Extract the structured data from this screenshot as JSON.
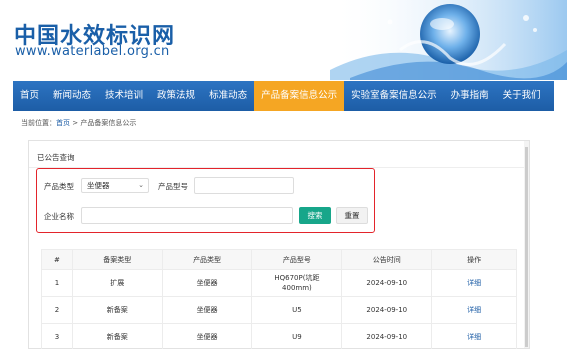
{
  "header": {
    "logo_title": "中国水效标识网",
    "logo_url": "www.waterlabel.org.cn"
  },
  "nav": {
    "items": [
      {
        "label": "首页"
      },
      {
        "label": "新闻动态"
      },
      {
        "label": "技术培训"
      },
      {
        "label": "政策法规"
      },
      {
        "label": "标准动态"
      },
      {
        "label": "产品备案信息公示",
        "active": true
      },
      {
        "label": "实验室备案信息公示"
      },
      {
        "label": "办事指南"
      },
      {
        "label": "关于我们"
      }
    ]
  },
  "breadcrumb": {
    "prefix": "当前位置：",
    "home": "首页",
    "separator": " > ",
    "current": "产品备案信息公示"
  },
  "panel": {
    "title": "已公告查询"
  },
  "search": {
    "product_type_label": "产品类型",
    "product_type_value": "坐便器",
    "product_model_label": "产品型号",
    "product_model_value": "",
    "company_label": "企业名称",
    "company_value": "",
    "search_button": "搜索",
    "reset_button": "重置"
  },
  "table": {
    "headers": [
      "#",
      "备案类型",
      "产品类型",
      "产品型号",
      "公告时间",
      "操作"
    ],
    "rows": [
      {
        "no": "1",
        "type": "扩展",
        "product": "坐便器",
        "model": "HQ670P(坑距400mm)",
        "date": "2024-09-10",
        "action": "详细"
      },
      {
        "no": "2",
        "type": "新备案",
        "product": "坐便器",
        "model": "U5",
        "date": "2024-09-10",
        "action": "详细"
      },
      {
        "no": "3",
        "type": "新备案",
        "product": "坐便器",
        "model": "U9",
        "date": "2024-09-10",
        "action": "详细"
      }
    ]
  },
  "colors": {
    "nav_bg": "#2167b3",
    "nav_active": "#f5a623",
    "search_button": "#17a68a",
    "highlight_border": "#e3242b",
    "link": "#1d5da6"
  }
}
